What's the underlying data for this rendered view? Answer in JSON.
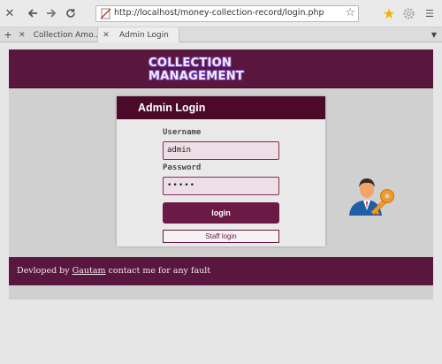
{
  "browser": {
    "url": "http://localhost/money-collection-record/login.php",
    "toolbar_icons": [
      "close-icon",
      "back-icon",
      "forward-icon",
      "reload-icon",
      "url-page-icon",
      "bookmark-star-icon",
      "favorites-star-icon",
      "settings-gear-icon"
    ]
  },
  "tabs": [
    {
      "label": "Collection Amo...",
      "active": false
    },
    {
      "label": "Admin Login",
      "active": true
    }
  ],
  "header": {
    "logo_text": "COLLECTION MANAGEMENT"
  },
  "login": {
    "title": "Admin Login",
    "username_label": "Username",
    "username_value": "admin",
    "password_label": "Password",
    "password_value": "•••••",
    "login_button": "login",
    "staff_button": "Staff login"
  },
  "footer": {
    "prefix": "Devloped by ",
    "link": "Gautam",
    "suffix": " contact me for any fault"
  },
  "colors": {
    "brand_purple": "#59173e",
    "card_header": "#4c0a2a",
    "button": "#6a1a45",
    "favorite_star": "#f2b400"
  }
}
